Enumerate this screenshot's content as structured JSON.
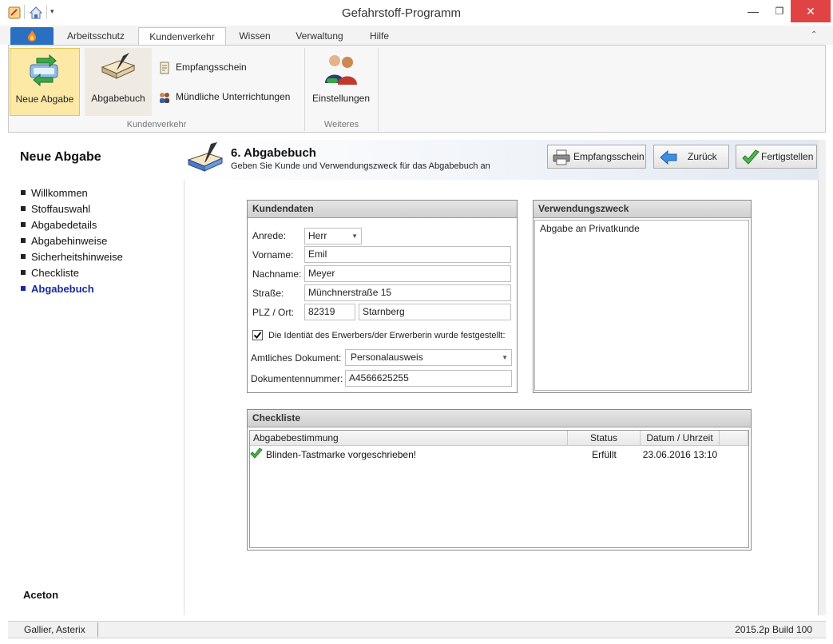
{
  "window": {
    "title": "Gefahrstoff-Programm"
  },
  "ribbon_tabs": [
    "Arbeitsschutz",
    "Kundenverkehr",
    "Wissen",
    "Verwaltung",
    "Hilfe"
  ],
  "active_tab": "Kundenverkehr",
  "ribbon": {
    "neue_abgabe": "Neue Abgabe",
    "abgabebuch": "Abgabebuch",
    "empfangsschein": "Empfangsschein",
    "muendliche": "Mündliche Unterrichtungen",
    "einstellungen": "Einstellungen",
    "group_kundenverkehr": "Kundenverkehr",
    "group_weiteres": "Weiteres"
  },
  "wizard": {
    "title": "Neue Abgabe",
    "steps": [
      "Willkommen",
      "Stoffauswahl",
      "Abgabedetails",
      "Abgabehinweise",
      "Sicherheitshinweise",
      "Checkliste",
      "Abgabebuch"
    ],
    "current_step": "Abgabebuch",
    "substance": "Aceton"
  },
  "header": {
    "title": "6. Abgabebuch",
    "subtitle": "Geben Sie Kunde und Verwendungszweck für das Abgabebuch an",
    "btn_empfangsschein": "Empfangsschein",
    "btn_zurueck": "Zurück",
    "btn_fertigstellen": "Fertigstellen"
  },
  "kundendaten": {
    "heading": "Kundendaten",
    "anrede_label": "Anrede:",
    "anrede_value": "Herr",
    "vorname_label": "Vorname:",
    "vorname_value": "Emil",
    "nachname_label": "Nachname:",
    "nachname_value": "Meyer",
    "strasse_label": "Straße:",
    "strasse_value": "Münchnerstraße 15",
    "plz_label": "PLZ / Ort:",
    "plz_value": "82319",
    "ort_value": "Starnberg",
    "identity_checked": true,
    "identity_label": "Die Identiät des Erwerbers/der Erwerberin wurde festgestellt:",
    "dokument_label": "Amtliches Dokument:",
    "dokument_value": "Personalausweis",
    "dokumentnr_label": "Dokumentennummer:",
    "dokumentnr_value": "A4566625255"
  },
  "verwendungszweck": {
    "heading": "Verwendungszweck",
    "text": "Abgabe an Privatkunde"
  },
  "checkliste": {
    "heading": "Checkliste",
    "columns": [
      "Abgabebestimmung",
      "Status",
      "Datum / Uhrzeit"
    ],
    "rows": [
      {
        "bestimmung": "Blinden-Tastmarke vorgeschrieben!",
        "status": "Erfüllt",
        "datum": "23.06.2016 13:10"
      }
    ]
  },
  "status": {
    "user": "Gallier, Asterix",
    "build": "2015.2p Build 100"
  }
}
